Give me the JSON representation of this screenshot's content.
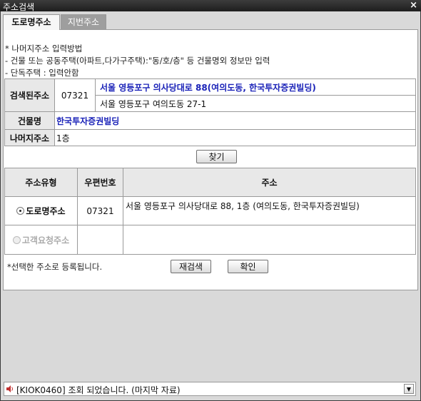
{
  "window": {
    "title": "주소검색",
    "close_label": "×"
  },
  "tabs": [
    {
      "label": "도로명주소"
    },
    {
      "label": "지번주소"
    }
  ],
  "instructions": [
    "* 나머지주소 입력방법",
    "- 건물 또는 공동주택(아파트,다가구주택):\"동/호/층\" 등 건물명외 정보만 입력",
    "- 단독주택 : 입력안함"
  ],
  "result": {
    "searched_label": "검색된주소",
    "postal_code": "07321",
    "road_address": "서울 영등포구 의사당대로 88(여의도동, 한국투자증권빌딩)",
    "jibun_address": "서울 영등포구 여의도동  27-1",
    "building_label": "건물명",
    "building_name": "한국투자증권빌딩",
    "remaining_label": "나머지주소",
    "remaining_value": "1층"
  },
  "find_button": "찾기",
  "select_table": {
    "headers": [
      "주소유형",
      "우편번호",
      "주소"
    ],
    "rows": [
      {
        "type": "도로명주소",
        "postal": "07321",
        "address": "서울 영등포구 의사당대로 88, 1층 (여의도동, 한국투자증권빌딩)",
        "selected": true
      },
      {
        "type": "고객요청주소",
        "postal": "",
        "address": "",
        "selected": false
      }
    ]
  },
  "footer_note": "*선택한 주소로 등록됩니다.",
  "buttons": {
    "research": "재검색",
    "confirm": "확인"
  },
  "status_bar": {
    "message": "[KIOK0460] 조회 되었습니다. (마지막 자료)"
  },
  "colors": {
    "accent_text": "#1a22b8",
    "title_bar": "#1e1e1e"
  }
}
